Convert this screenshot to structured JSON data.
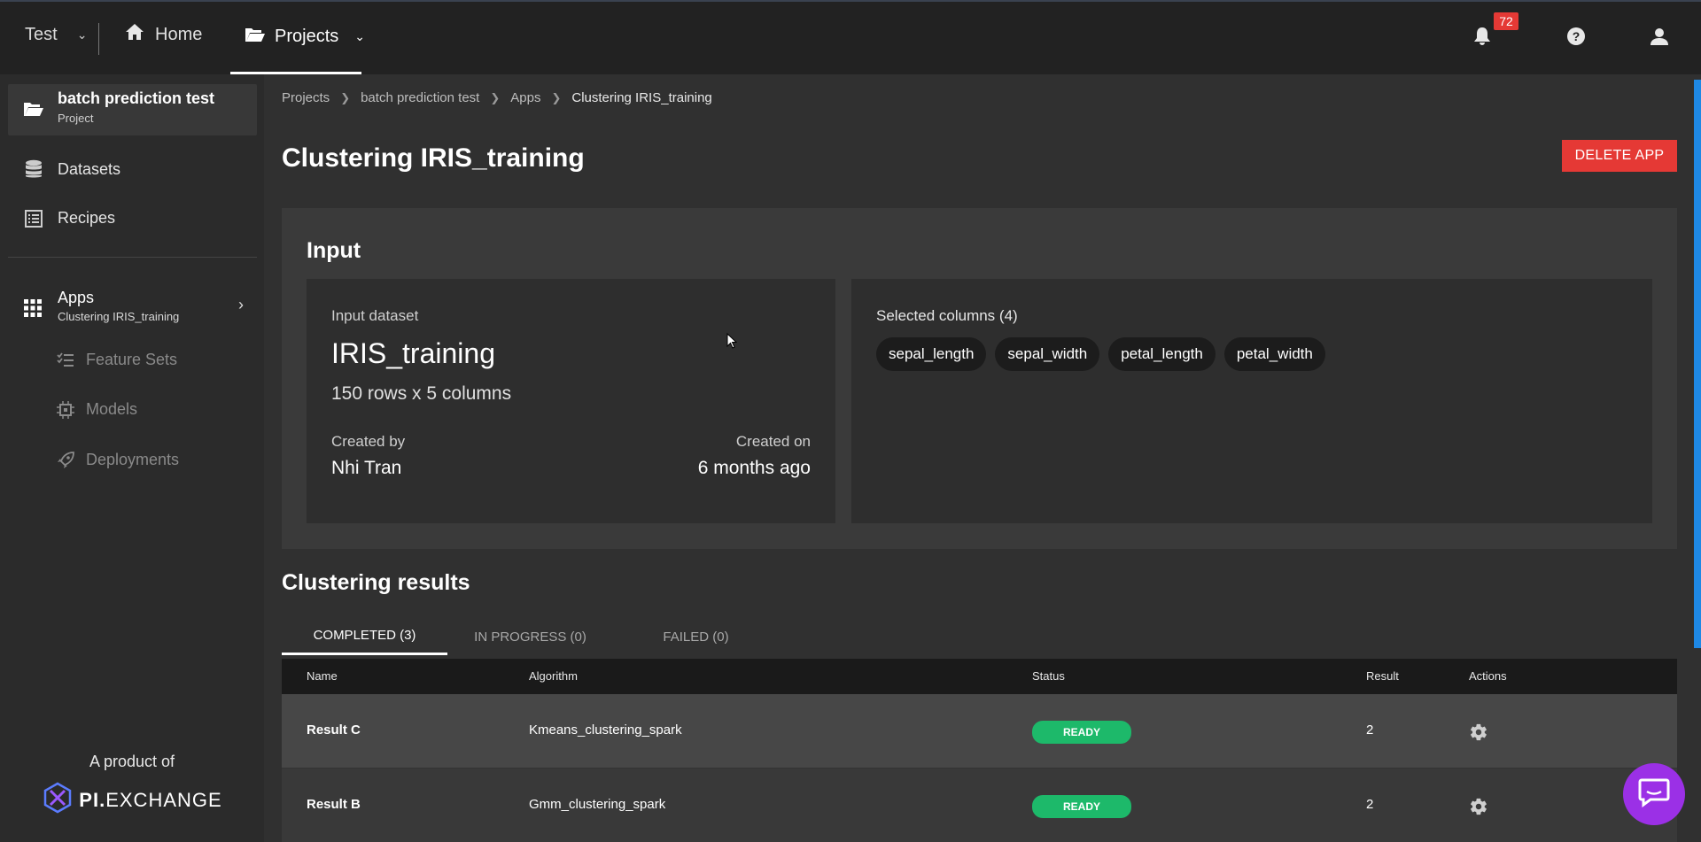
{
  "topbar": {
    "workspace": "Test",
    "home_label": "Home",
    "projects_label": "Projects",
    "notification_count": "72"
  },
  "sidebar": {
    "project": {
      "title": "batch prediction test",
      "subtitle": "Project"
    },
    "items": [
      {
        "label": "Datasets",
        "icon": "database-icon"
      },
      {
        "label": "Recipes",
        "icon": "list-icon"
      }
    ],
    "apps": {
      "title": "Apps",
      "subtitle": "Clustering IRIS_training"
    },
    "sub_items": [
      {
        "label": "Feature Sets",
        "icon": "checklist-icon"
      },
      {
        "label": "Models",
        "icon": "chip-icon"
      },
      {
        "label": "Deployments",
        "icon": "rocket-icon"
      }
    ],
    "footer": {
      "by": "A product of",
      "logo_pi": "PI.",
      "logo_rest": "EXCHANGE"
    }
  },
  "breadcrumb": [
    "Projects",
    "batch prediction test",
    "Apps",
    "Clustering IRIS_training"
  ],
  "page": {
    "title": "Clustering IRIS_training",
    "delete_label": "DELETE APP"
  },
  "input": {
    "heading": "Input",
    "dataset_label": "Input dataset",
    "dataset_name": "IRIS_training",
    "dataset_size": "150 rows x 5 columns",
    "created_by_label": "Created by",
    "created_by": "Nhi Tran",
    "created_on_label": "Created on",
    "created_on": "6 months ago",
    "selected_label": "Selected columns (4)",
    "columns": [
      "sepal_length",
      "sepal_width",
      "petal_length",
      "petal_width"
    ]
  },
  "results": {
    "title": "Clustering results",
    "tabs": [
      "COMPLETED (3)",
      "IN PROGRESS (0)",
      "FAILED (0)"
    ],
    "headers": [
      "Name",
      "Algorithm",
      "Status",
      "Result",
      "Actions"
    ],
    "rows": [
      {
        "name": "Result C",
        "algorithm": "Kmeans_clustering_spark",
        "status": "READY",
        "result": "2"
      },
      {
        "name": "Result B",
        "algorithm": "Gmm_clustering_spark",
        "status": "READY",
        "result": "2"
      }
    ]
  },
  "colors": {
    "accent": "#e53935",
    "ready": "#1db96a",
    "chat": "#9b30e6",
    "scroll": "#1e88e5"
  }
}
